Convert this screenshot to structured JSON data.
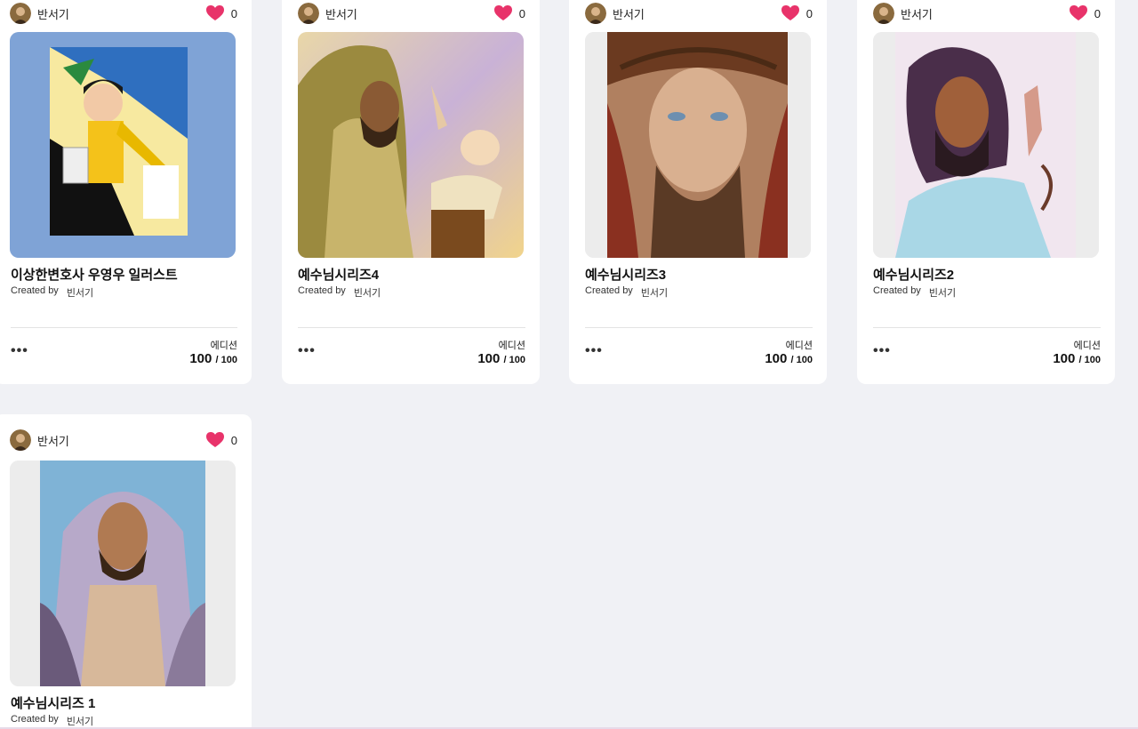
{
  "cards": [
    {
      "owner": "반서기",
      "likes": "0",
      "title": "이상한변호사 우영우 일러스트",
      "created_by_label": "Created by",
      "creator": "빈서기",
      "edition_label": "에디션",
      "edition_count": "100",
      "edition_total": "/ 100",
      "artwork_icon": "illustration-artwork"
    },
    {
      "owner": "반서기",
      "likes": "0",
      "title": "예수님시리즈4",
      "created_by_label": "Created by",
      "creator": "빈서기",
      "edition_label": "에디션",
      "edition_count": "100",
      "edition_total": "/ 100",
      "artwork_icon": "jesus-holding-baby-artwork"
    },
    {
      "owner": "반서기",
      "likes": "0",
      "title": "예수님시리즈3",
      "created_by_label": "Created by",
      "creator": "빈서기",
      "edition_label": "에디션",
      "edition_count": "100",
      "edition_total": "/ 100",
      "artwork_icon": "jesus-crown-of-thorns-artwork"
    },
    {
      "owner": "반서기",
      "likes": "0",
      "title": "예수님시리즈2",
      "created_by_label": "Created by",
      "creator": "빈서기",
      "edition_label": "에디션",
      "edition_count": "100",
      "edition_total": "/ 100",
      "artwork_icon": "jesus-profile-artwork"
    },
    {
      "owner": "반서기",
      "likes": "0",
      "title": "예수님시리즈 1",
      "created_by_label": "Created by",
      "creator": "빈서기",
      "artwork_icon": "jesus-portrait-artwork"
    }
  ],
  "more_label": "•••",
  "colors": {
    "background": "#f0f1f5",
    "heart": "#e8336a",
    "card": "#ffffff"
  }
}
